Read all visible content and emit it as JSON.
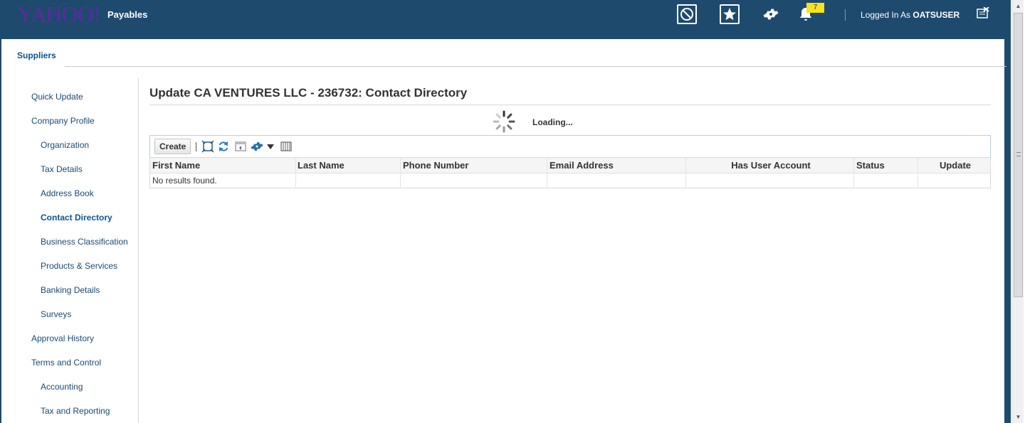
{
  "header": {
    "logo": "YAHOO",
    "logo_excl": "!",
    "app_name": "Payables",
    "notification_count": "7",
    "logged_in_prefix": "Logged In As",
    "username": "OATSUSER",
    "bg_color": "#1e4a6e"
  },
  "tabs": {
    "suppliers": "Suppliers"
  },
  "leftnav": {
    "items": [
      {
        "label": "Quick Update",
        "level": 1
      },
      {
        "label": "Company Profile",
        "level": 1
      },
      {
        "label": "Organization",
        "level": 2
      },
      {
        "label": "Tax Details",
        "level": 2
      },
      {
        "label": "Address Book",
        "level": 2
      },
      {
        "label": "Contact Directory",
        "level": 2,
        "active": true
      },
      {
        "label": "Business Classification",
        "level": 2
      },
      {
        "label": "Products & Services",
        "level": 2
      },
      {
        "label": "Banking Details",
        "level": 2
      },
      {
        "label": "Surveys",
        "level": 2
      },
      {
        "label": "Approval History",
        "level": 1
      },
      {
        "label": "Terms and Control",
        "level": 1
      },
      {
        "label": "Accounting",
        "level": 2
      },
      {
        "label": "Tax and Reporting",
        "level": 2
      }
    ]
  },
  "main": {
    "title": "Update CA VENTURES LLC - 236732: Contact Directory",
    "loading": "Loading...",
    "toolbar": {
      "create_label": "Create",
      "icons": [
        "detach-icon",
        "refresh-icon",
        "freeze-icon",
        "settings-icon",
        "dropdown-icon",
        "columns-icon"
      ]
    },
    "table": {
      "columns": [
        "First Name",
        "Last Name",
        "Phone Number",
        "Email Address",
        "Has User Account",
        "Status",
        "Update"
      ],
      "empty_message": "No results found."
    }
  }
}
